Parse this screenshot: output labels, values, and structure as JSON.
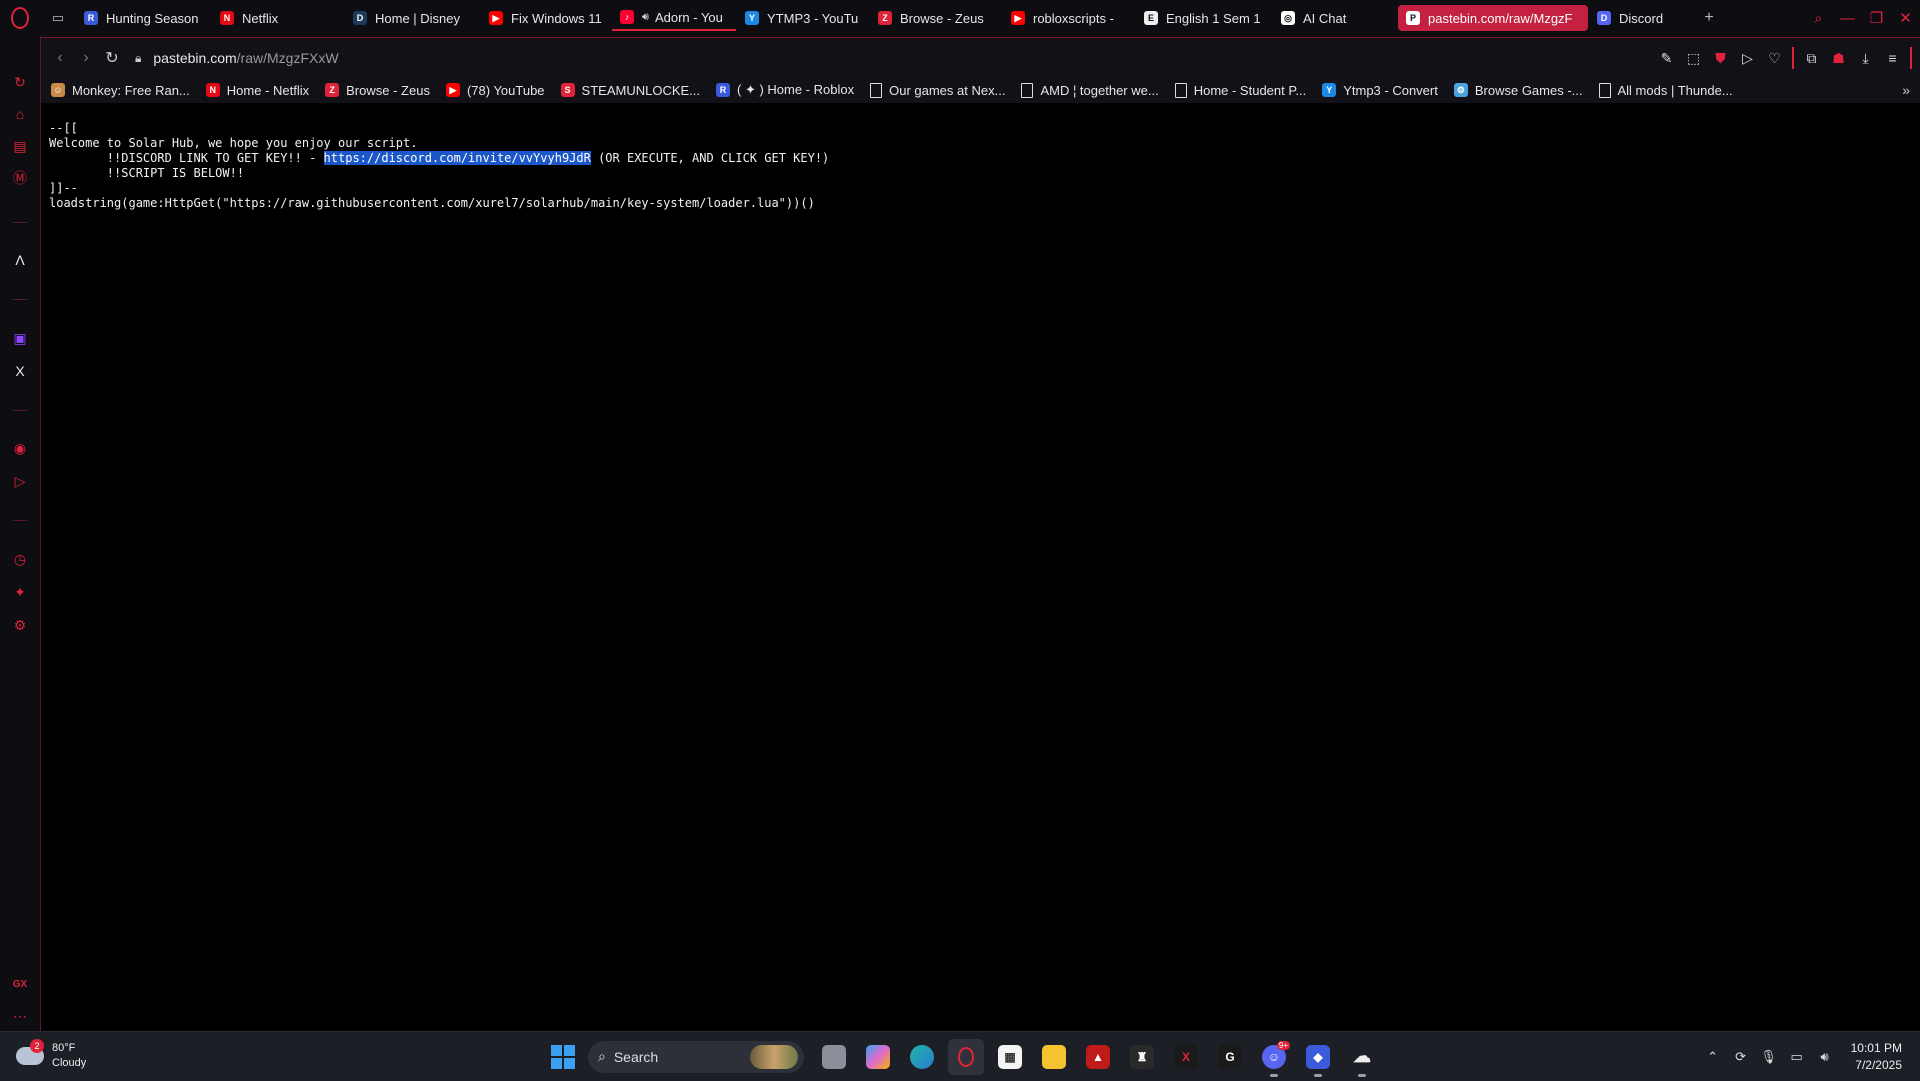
{
  "browser": {
    "tabs": [
      {
        "label": "Hunting Season",
        "icon": "roblox-icon",
        "color": "#3b5bdb",
        "glyph": "R"
      },
      {
        "label": "Netflix",
        "icon": "netflix-icon",
        "color": "#e50914",
        "glyph": "N"
      },
      {
        "label": "Home | Disney",
        "icon": "disney-icon",
        "color": "#1a3a5a",
        "glyph": "D"
      },
      {
        "label": "Fix Windows 11",
        "icon": "youtube-icon",
        "color": "#ff0000",
        "glyph": "▶"
      },
      {
        "label": "Adorn - You",
        "icon": "youtube-music-icon",
        "color": "#ff0033",
        "glyph": "♪"
      },
      {
        "label": "YTMP3 - YouTu",
        "icon": "ytmp3-icon",
        "color": "#1e88e5",
        "glyph": "Y"
      },
      {
        "label": "Browse - Zeus",
        "icon": "zeus-icon",
        "color": "#e0233a",
        "glyph": "Z"
      },
      {
        "label": "robloxscripts -",
        "icon": "youtube-icon",
        "color": "#ff0000",
        "glyph": "▶"
      },
      {
        "label": "English 1 Sem 1",
        "icon": "document-icon",
        "color": "#eeeeee",
        "glyph": "E"
      },
      {
        "label": "AI Chat",
        "icon": "ai-chat-icon",
        "color": "#ffffff",
        "glyph": "◎"
      },
      {
        "label": "pastebin.com/raw/MzgzF",
        "icon": "pastebin-icon",
        "color": "#ffffff",
        "glyph": "P"
      },
      {
        "label": "Discord",
        "icon": "discord-icon",
        "color": "#5865f2",
        "glyph": "D"
      }
    ],
    "address": {
      "domain": "pastebin.com",
      "path": "/raw/MzgzFXxW"
    },
    "bookmarks": [
      {
        "label": "Monkey: Free Ran...",
        "icon": "monkey-icon",
        "color": "#c98a4a",
        "glyph": "☺"
      },
      {
        "label": "Home - Netflix",
        "icon": "netflix-icon",
        "color": "#e50914",
        "glyph": "N"
      },
      {
        "label": "Browse - Zeus",
        "icon": "zeus-icon",
        "color": "#e0233a",
        "glyph": "Z"
      },
      {
        "label": "(78) YouTube",
        "icon": "youtube-icon",
        "color": "#ff0000",
        "glyph": "▶"
      },
      {
        "label": "STEAMUNLOCKE...",
        "icon": "steamunlocked-icon",
        "color": "#e0233a",
        "glyph": "S"
      },
      {
        "label": "( ✦ ) Home - Roblox",
        "icon": "roblox-icon",
        "color": "#3b5bdb",
        "glyph": "R"
      },
      {
        "label": "Our games at Nex...",
        "icon": "document-icon",
        "color": "#dddddd",
        "glyph": ""
      },
      {
        "label": "AMD ¦ together we...",
        "icon": "document-icon",
        "color": "#dddddd",
        "glyph": ""
      },
      {
        "label": "Home - Student P...",
        "icon": "document-icon",
        "color": "#dddddd",
        "glyph": ""
      },
      {
        "label": "Ytmp3 - Convert",
        "icon": "ytmp3-icon",
        "color": "#1e88e5",
        "glyph": "Y"
      },
      {
        "label": "Browse Games -...",
        "icon": "gear-icon",
        "color": "#4aa3df",
        "glyph": "⚙"
      },
      {
        "label": "All mods | Thunde...",
        "icon": "document-icon",
        "color": "#dddddd",
        "glyph": ""
      }
    ]
  },
  "page": {
    "code_line1": "--[[",
    "code_line2": "Welcome to Solar Hub, we hope you enjoy our script.",
    "code_line3_pre": "        !!DISCORD LINK TO GET KEY!! - ",
    "code_line3_link": "https://discord.com/invite/vvYvyh9JdR",
    "code_line3_post": " (OR EXECUTE, AND CLICK GET KEY!)",
    "code_line4": "        !!SCRIPT IS BELOW!!",
    "code_line5": "]]--",
    "code_line6": "loadstring(game:HttpGet(\"https://raw.githubusercontent.com/xurel7/solarhub/main/key-system/loader.lua\"))()"
  },
  "sidebar": {
    "gx_label": "GX"
  },
  "taskbar": {
    "weather_temp": "80°F",
    "weather_desc": "Cloudy",
    "weather_badge": "2",
    "search_label": "Search",
    "discord_badge": "9+",
    "time": "10:01 PM",
    "date": "7/2/2025"
  }
}
